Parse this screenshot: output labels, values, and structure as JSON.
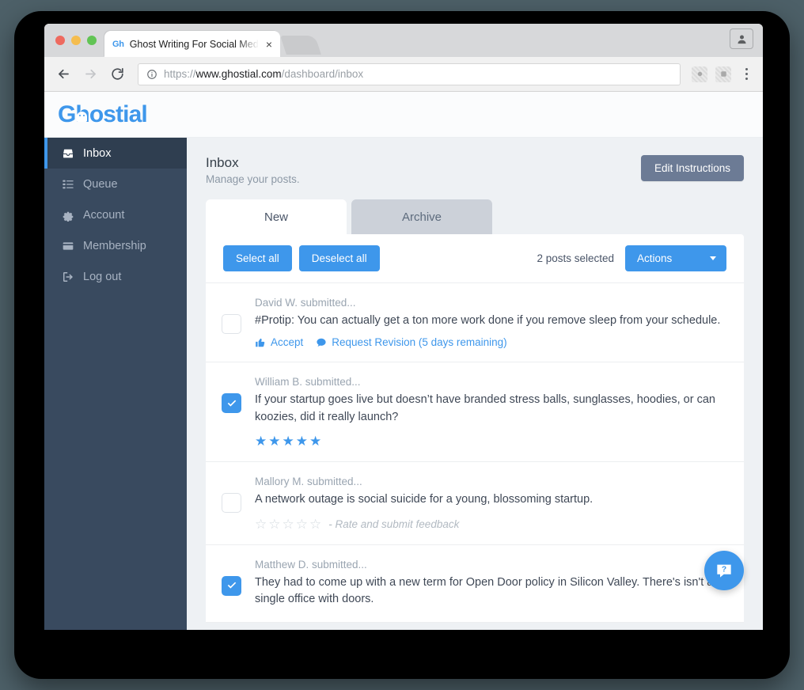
{
  "browser": {
    "tab": {
      "favicon_text": "Gh",
      "title": "Ghost Writing For Social Media",
      "close_label": "×"
    },
    "url": {
      "scheme": "https://",
      "host": "www.ghostial.com",
      "path": "/dashboard/inbox"
    }
  },
  "brand": {
    "name": "Ghostial"
  },
  "sidebar": {
    "items": [
      {
        "label": "Inbox",
        "icon": "inbox-icon",
        "active": true
      },
      {
        "label": "Queue",
        "icon": "list-icon",
        "active": false
      },
      {
        "label": "Account",
        "icon": "gear-icon",
        "active": false
      },
      {
        "label": "Membership",
        "icon": "credit-card-icon",
        "active": false
      },
      {
        "label": "Log out",
        "icon": "sign-out-icon",
        "active": false
      }
    ]
  },
  "page": {
    "title": "Inbox",
    "subtitle": "Manage your posts.",
    "edit_instructions_label": "Edit Instructions"
  },
  "tabs": [
    {
      "label": "New",
      "active": true
    },
    {
      "label": "Archive",
      "active": false
    }
  ],
  "toolbar": {
    "select_all_label": "Select all",
    "deselect_all_label": "Deselect all",
    "selection_count_text": "2 posts selected",
    "actions_label": "Actions"
  },
  "posts": [
    {
      "author": "David W. submitted...",
      "text": "#Protip: You can actually get a ton more work done if you remove sleep from your schedule.",
      "checked": false,
      "accept_label": "Accept",
      "revision_label": "Request Revision (5 days remaining)"
    },
    {
      "author": "William B. submitted...",
      "text": "If your startup goes live but doesn’t have branded stress balls, sunglasses, hoodies, or can koozies, did it really launch?",
      "checked": true,
      "rating": 5
    },
    {
      "author": "Mallory M. submitted...",
      "text": "A network outage is social suicide for a young, blossoming startup.",
      "checked": false,
      "rating": 0,
      "rate_hint": "- Rate and submit feedback"
    },
    {
      "author": "Matthew D. submitted...",
      "text": "They had to come up with a new term for Open Door policy in Silicon Valley. There's isn't a single office with doors.",
      "checked": true
    }
  ],
  "help": {
    "label": "?"
  },
  "colors": {
    "accent_blue": "#3e97eb",
    "sidebar_bg": "#394a5f",
    "sidebar_active_bg": "#2f3e50",
    "edit_button": "#6c7b95",
    "tab_idle": "#ccd1d9",
    "page_bg": "#eef1f4"
  }
}
